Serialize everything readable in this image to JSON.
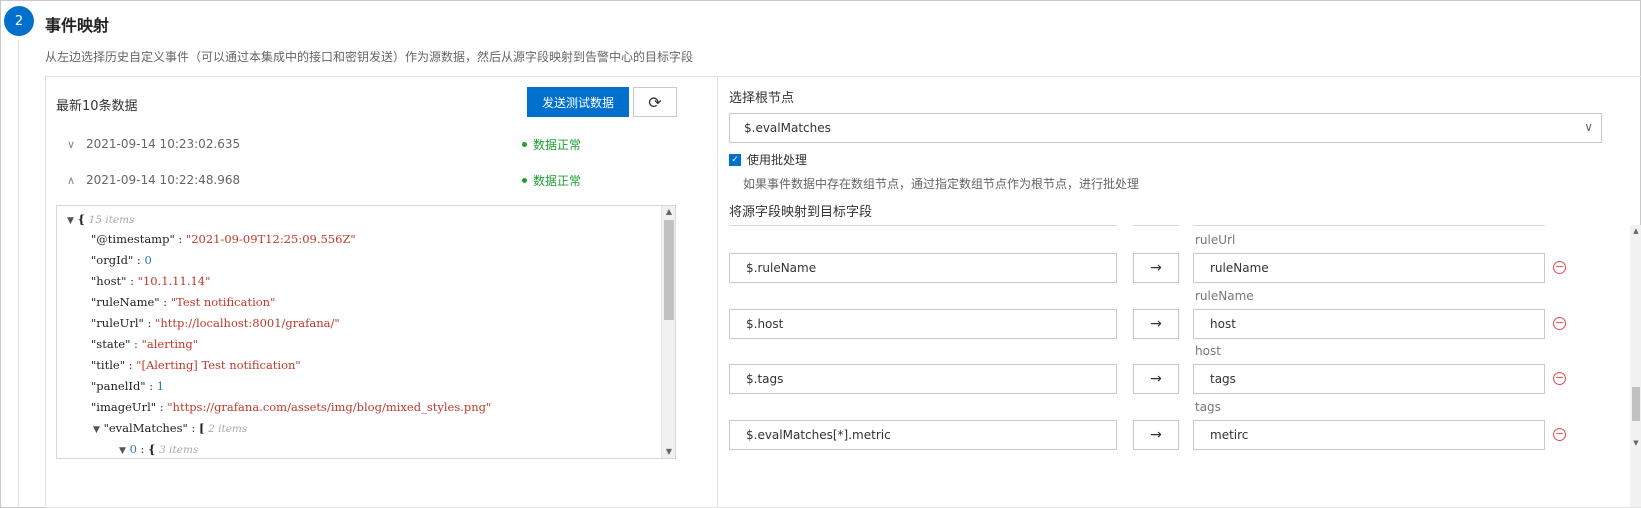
{
  "step": {
    "number": "2",
    "title": "事件映射",
    "description": "从左边选择历史自定义事件（可以通过本集成中的接口和密钥发送）作为源数据，然后从源字段映射到告警中心的目标字段"
  },
  "left": {
    "title": "最新10条数据",
    "send_button": "发送测试数据",
    "refresh_icon": "refresh-icon",
    "records": [
      {
        "timestamp": "2021-09-14 10:23:02.635",
        "status": "数据正常",
        "expanded": false
      },
      {
        "timestamp": "2021-09-14 10:22:48.968",
        "status": "数据正常",
        "expanded": true
      }
    ],
    "json": {
      "root_meta": "15 items",
      "fields": [
        {
          "key": "\"@timestamp\"",
          "value": "\"2021-09-09T12:25:09.556Z\"",
          "kind": "string"
        },
        {
          "key": "\"orgId\"",
          "value": "0",
          "kind": "number"
        },
        {
          "key": "\"host\"",
          "value": "\"10.1.11.14\"",
          "kind": "string"
        },
        {
          "key": "\"ruleName\"",
          "value": "\"Test notification\"",
          "kind": "string"
        },
        {
          "key": "\"ruleUrl\"",
          "value": "\"http://localhost:8001/grafana/\"",
          "kind": "string"
        },
        {
          "key": "\"state\"",
          "value": "\"alerting\"",
          "kind": "string"
        },
        {
          "key": "\"title\"",
          "value": "\"[Alerting] Test notification\"",
          "kind": "string"
        },
        {
          "key": "\"panelId\"",
          "value": "1",
          "kind": "number"
        },
        {
          "key": "\"imageUrl\"",
          "value": "\"https://grafana.com/assets/img/blog/mixed_styles.png\"",
          "kind": "string"
        }
      ],
      "eval_key": "\"evalMatches\"",
      "eval_meta": "2 items",
      "item_index": "0",
      "item_meta": "3 items"
    }
  },
  "right": {
    "root_title": "选择根节点",
    "root_value": "$.evalMatches",
    "batch_label": "使用批处理",
    "batch_desc": "如果事件数据中存在数组节点，通过指定数组节点作为根节点，进行批处理",
    "mapping_title": "将源字段映射到目标字段",
    "mappings": [
      {
        "label": "ruleUrl",
        "source": "$.ruleName",
        "target": "ruleName"
      },
      {
        "label": "ruleName",
        "source": "$.host",
        "target": "host"
      },
      {
        "label": "host",
        "source": "$.tags",
        "target": "tags"
      },
      {
        "label": "tags",
        "source": "$.evalMatches[*].metric",
        "target": "metirc"
      }
    ]
  },
  "colors": {
    "primary": "#0070cc",
    "ok": "#1e9e33",
    "danger": "#e04b4b"
  }
}
